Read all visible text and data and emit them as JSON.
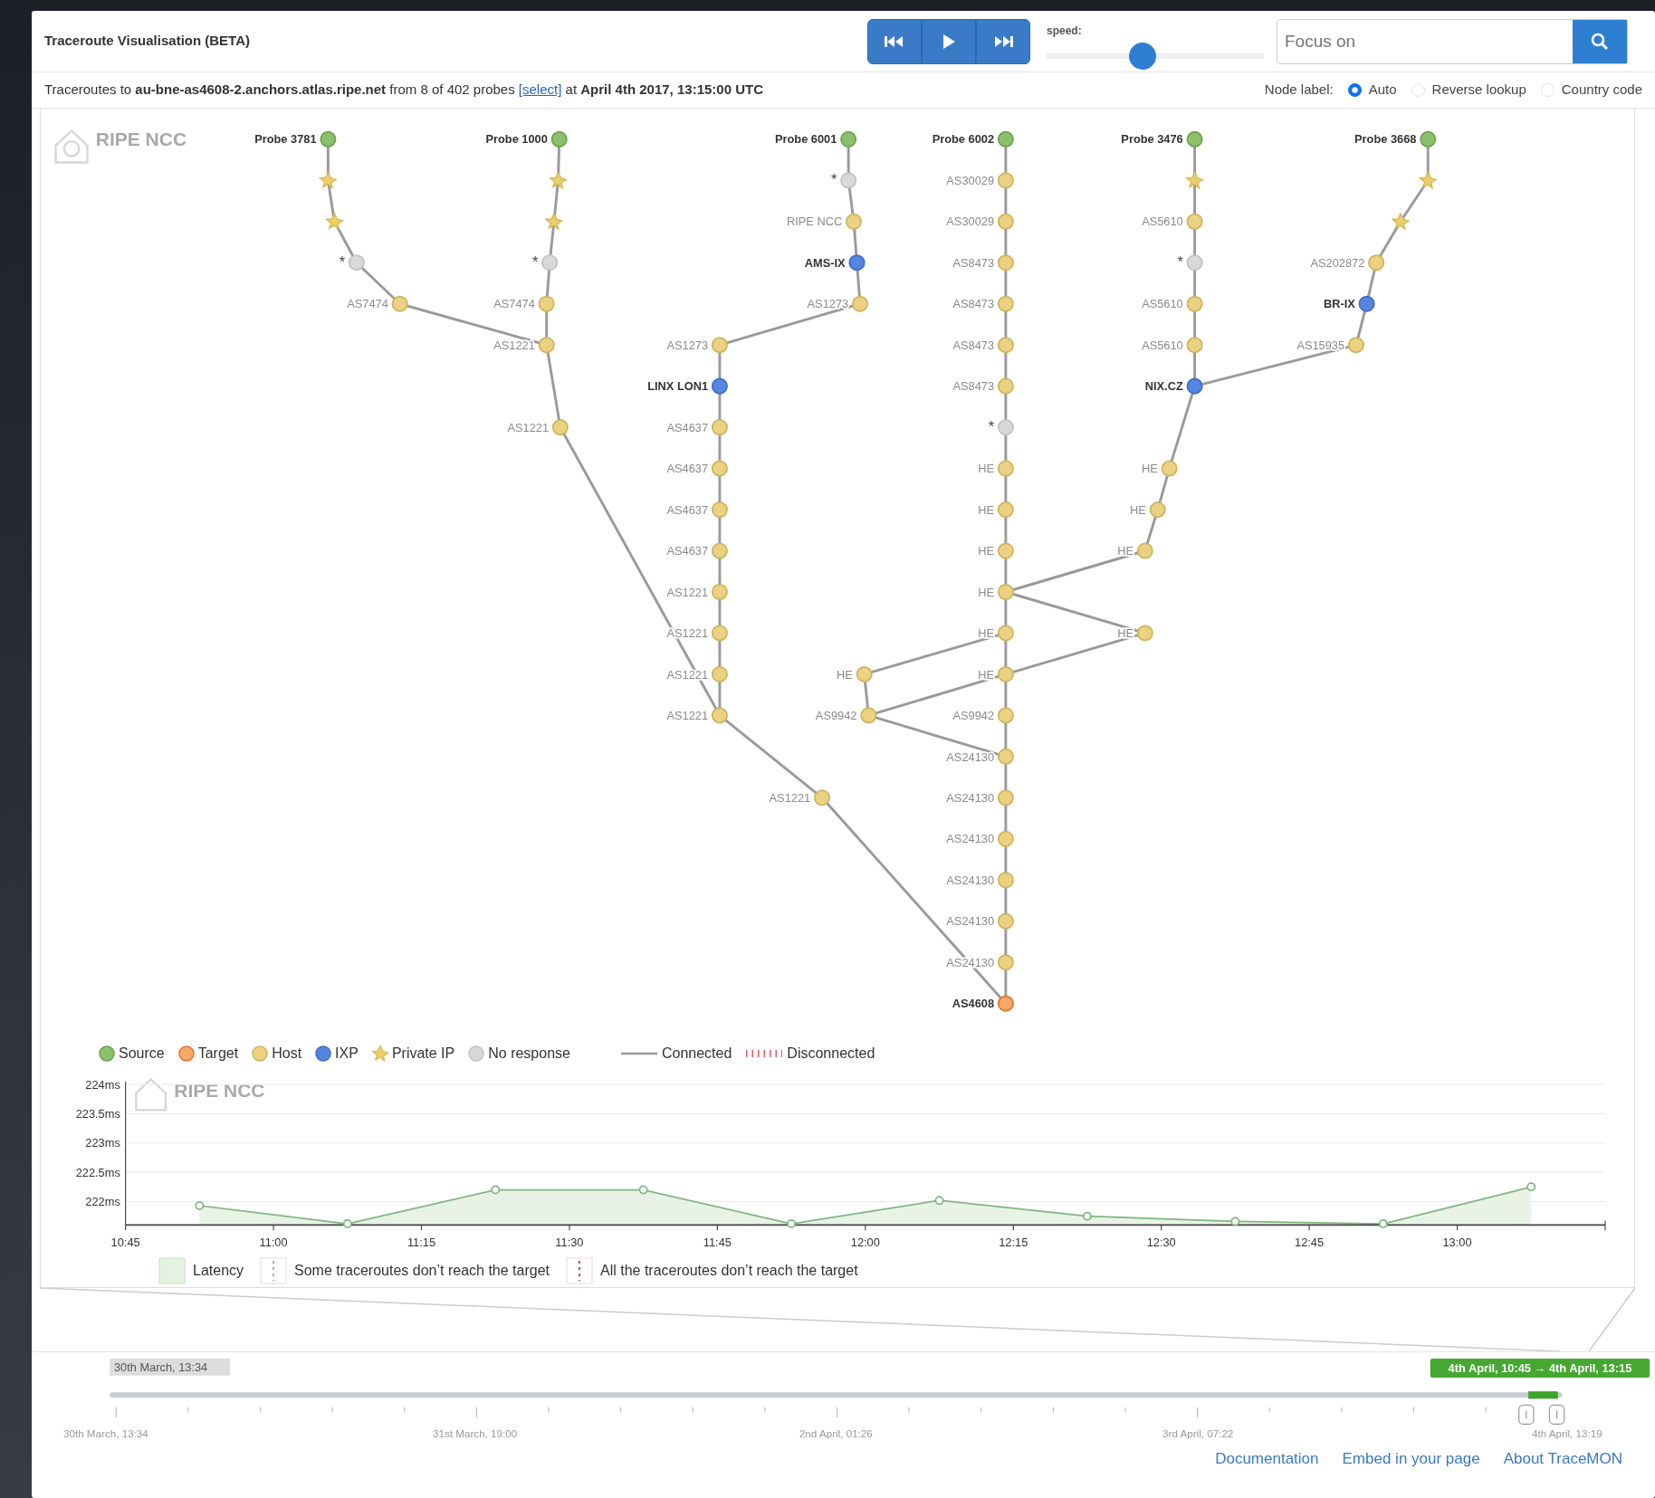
{
  "header": {
    "title": "Traceroute Visualisation (BETA)",
    "speed": {
      "label": "speed:",
      "level": 0.44
    },
    "search": {
      "placeholder": "Focus on"
    }
  },
  "info": {
    "text": "Traceroutes to **au-bne-as4608-2.anchors.atlas.ripe.net** from 8 of 402 probes",
    "link": "[select]",
    "text_after": "at **April 4th 2017, 13:15:00 UTC**"
  },
  "node_label": {
    "label": "Node label:",
    "options": [
      {
        "label": "Auto",
        "selected": true
      },
      {
        "label": "Reverse lookup",
        "selected": false
      },
      {
        "label": "Country code",
        "selected": false
      }
    ]
  },
  "graph": {
    "logo": "RIPE NCC",
    "nodes": [
      {
        "kind": "source",
        "label": "Probe 3781"
      },
      {
        "kind": "private"
      },
      {
        "kind": "private"
      },
      {
        "kind": "noresponse",
        "label": "*"
      },
      {
        "kind": "host",
        "label": "AS7474"
      },
      {
        "kind": "source",
        "label": "Probe 1000"
      },
      {
        "kind": "private"
      },
      {
        "kind": "private"
      },
      {
        "kind": "noresponse",
        "label": "*"
      },
      {
        "kind": "host",
        "label": "AS7474"
      },
      {
        "kind": "host",
        "label": "AS1221"
      },
      {
        "kind": "host",
        "label": "AS1221"
      },
      {
        "kind": "source",
        "label": "Probe 6001"
      },
      {
        "kind": "noresponse",
        "label": "*"
      },
      {
        "kind": "host",
        "label": "RIPE NCC"
      },
      {
        "kind": "ixp",
        "label": "AMS-IX"
      },
      {
        "kind": "host",
        "label": "AS1273"
      },
      {
        "kind": "host",
        "label": "AS1273"
      },
      {
        "kind": "ixp",
        "label": "LINX LON1"
      },
      {
        "kind": "host",
        "label": "AS4637"
      },
      {
        "kind": "host",
        "label": "AS4637"
      },
      {
        "kind": "host",
        "label": "AS4637"
      },
      {
        "kind": "host",
        "label": "AS4637"
      },
      {
        "kind": "host",
        "label": "AS1221"
      },
      {
        "kind": "host",
        "label": "AS1221"
      },
      {
        "kind": "host",
        "label": "AS1221"
      },
      {
        "kind": "host",
        "label": "AS1221"
      },
      {
        "kind": "host",
        "label": "AS1221"
      },
      {
        "kind": "source",
        "label": "Probe 6002"
      },
      {
        "kind": "host",
        "label": "AS30029"
      },
      {
        "kind": "host",
        "label": "AS30029"
      },
      {
        "kind": "host",
        "label": "AS8473"
      },
      {
        "kind": "host",
        "label": "AS8473"
      },
      {
        "kind": "host",
        "label": "AS8473"
      },
      {
        "kind": "host",
        "label": "AS8473"
      },
      {
        "kind": "noresponse",
        "label": "*"
      },
      {
        "kind": "host",
        "label": "HE"
      },
      {
        "kind": "host",
        "label": "HE"
      },
      {
        "kind": "host",
        "label": "HE"
      },
      {
        "kind": "host",
        "label": "HE"
      },
      {
        "kind": "host",
        "label": "HE"
      },
      {
        "kind": "host",
        "label": "HE"
      },
      {
        "kind": "host",
        "label": "AS9942"
      },
      {
        "kind": "host",
        "label": "AS24130"
      },
      {
        "kind": "host",
        "label": "AS24130"
      },
      {
        "kind": "host",
        "label": "AS24130"
      },
      {
        "kind": "host",
        "label": "AS24130"
      },
      {
        "kind": "host",
        "label": "AS24130"
      },
      {
        "kind": "host",
        "label": "AS24130"
      },
      {
        "kind": "target",
        "label": "AS4608"
      },
      {
        "kind": "source",
        "label": "Probe 3476"
      },
      {
        "kind": "private"
      },
      {
        "kind": "host",
        "label": "AS5610"
      },
      {
        "kind": "noresponse",
        "label": "*"
      },
      {
        "kind": "host",
        "label": "AS5610"
      },
      {
        "kind": "host",
        "label": "AS5610"
      },
      {
        "kind": "ixp",
        "label": "NIX.CZ"
      },
      {
        "kind": "host",
        "label": "HE"
      },
      {
        "kind": "host",
        "label": "HE"
      },
      {
        "kind": "host",
        "label": "HE"
      },
      {
        "kind": "host",
        "label": "HE"
      },
      {
        "kind": "source",
        "label": "Probe 3668"
      },
      {
        "kind": "private"
      },
      {
        "kind": "private"
      },
      {
        "kind": "host",
        "label": "AS202872"
      },
      {
        "kind": "ixp",
        "label": "BR-IX"
      },
      {
        "kind": "host",
        "label": "AS15935"
      },
      {
        "kind": "host",
        "label": "HE"
      },
      {
        "kind": "host",
        "label": "AS9942"
      }
    ]
  },
  "legend": [
    {
      "kind": "source",
      "label": "Source"
    },
    {
      "kind": "target",
      "label": "Target"
    },
    {
      "kind": "host",
      "label": "Host"
    },
    {
      "kind": "ixp",
      "label": "IXP"
    },
    {
      "kind": "private",
      "label": "Private IP"
    },
    {
      "kind": "noresponse",
      "label": "No response"
    },
    {
      "kind": "connected",
      "label": "Connected"
    },
    {
      "kind": "disconnected",
      "label": "Disconnected"
    }
  ],
  "latency_chart": {
    "logo": "RIPE NCC",
    "chart_data": {
      "type": "area",
      "x": [
        652.5,
        667.5,
        682.5,
        697.5,
        712.5,
        727.5,
        742.5,
        757.5,
        772.5,
        787.5
      ],
      "series": [
        {
          "name": "Latency",
          "color": "#7fb77e",
          "values": [
            221.93,
            221.62,
            222.2,
            222.2,
            221.62,
            222.02,
            221.75,
            221.66,
            221.62,
            222.25
          ]
        }
      ],
      "xlim": [
        645,
        795
      ],
      "ylim": [
        221.6,
        224.05
      ],
      "grid": true,
      "xticks": [
        {
          "value": 645,
          "label": "10:45"
        },
        {
          "value": 660,
          "label": "11:00"
        },
        {
          "value": 675,
          "label": "11:15"
        },
        {
          "value": 690,
          "label": "11:30"
        },
        {
          "value": 705,
          "label": "11:45"
        },
        {
          "value": 720,
          "label": "12:00"
        },
        {
          "value": 735,
          "label": "12:15"
        },
        {
          "value": 750,
          "label": "12:30"
        },
        {
          "value": 765,
          "label": "12:45"
        },
        {
          "value": 780,
          "label": "13:00"
        }
      ],
      "yticks": [
        {
          "value": 222,
          "label": "222ms"
        },
        {
          "value": 222.5,
          "label": "222.5ms"
        },
        {
          "value": 223,
          "label": "223ms"
        },
        {
          "value": 223.5,
          "label": "223.5ms"
        },
        {
          "value": 224,
          "label": "224ms"
        }
      ]
    },
    "legend": [
      {
        "kind": "some",
        "label": "Some traceroutes don’t reach the target"
      },
      {
        "kind": "all",
        "label": "All the traceroutes don’t reach the target"
      }
    ]
  },
  "timeline": {
    "start_label": "30th March, 13:34",
    "range": "4th April, 10:45 → 4th April, 13:15",
    "ticks": [
      "30th March, 13:34",
      "31st March, 19:00",
      "2nd April, 01:26",
      "3rd April, 07:22",
      "4th April, 13:19"
    ]
  },
  "footer_links": [
    "Documentation",
    "Embed in your page",
    "About TraceMON"
  ]
}
